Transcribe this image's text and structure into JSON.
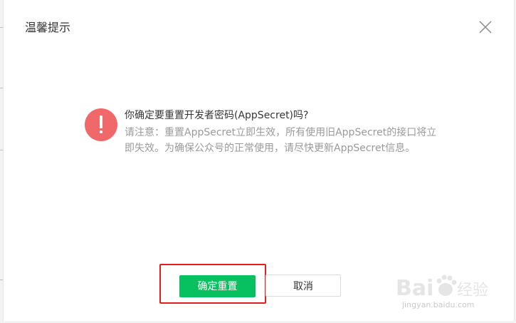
{
  "dialog": {
    "title": "温馨提示",
    "message_title": "你确定要重置开发者密码(AppSecret)吗?",
    "message_desc": "请注意：重置AppSecret立即生效，所有使用旧AppSecret的接口将立即失效。为确保公众号的正常使用，请尽快更新AppSecret信息。",
    "confirm_label": "确定重置",
    "cancel_label": "取消",
    "icon": "warning-icon",
    "close_icon": "close-icon"
  },
  "watermark": {
    "brand": "Baidu 经验",
    "url": "jingyan.baidu.com"
  },
  "colors": {
    "primary": "#07c160",
    "warning": "#f0686a",
    "highlight": "#e02020",
    "title_text": "#353535",
    "desc_text": "#9a9a9a"
  }
}
